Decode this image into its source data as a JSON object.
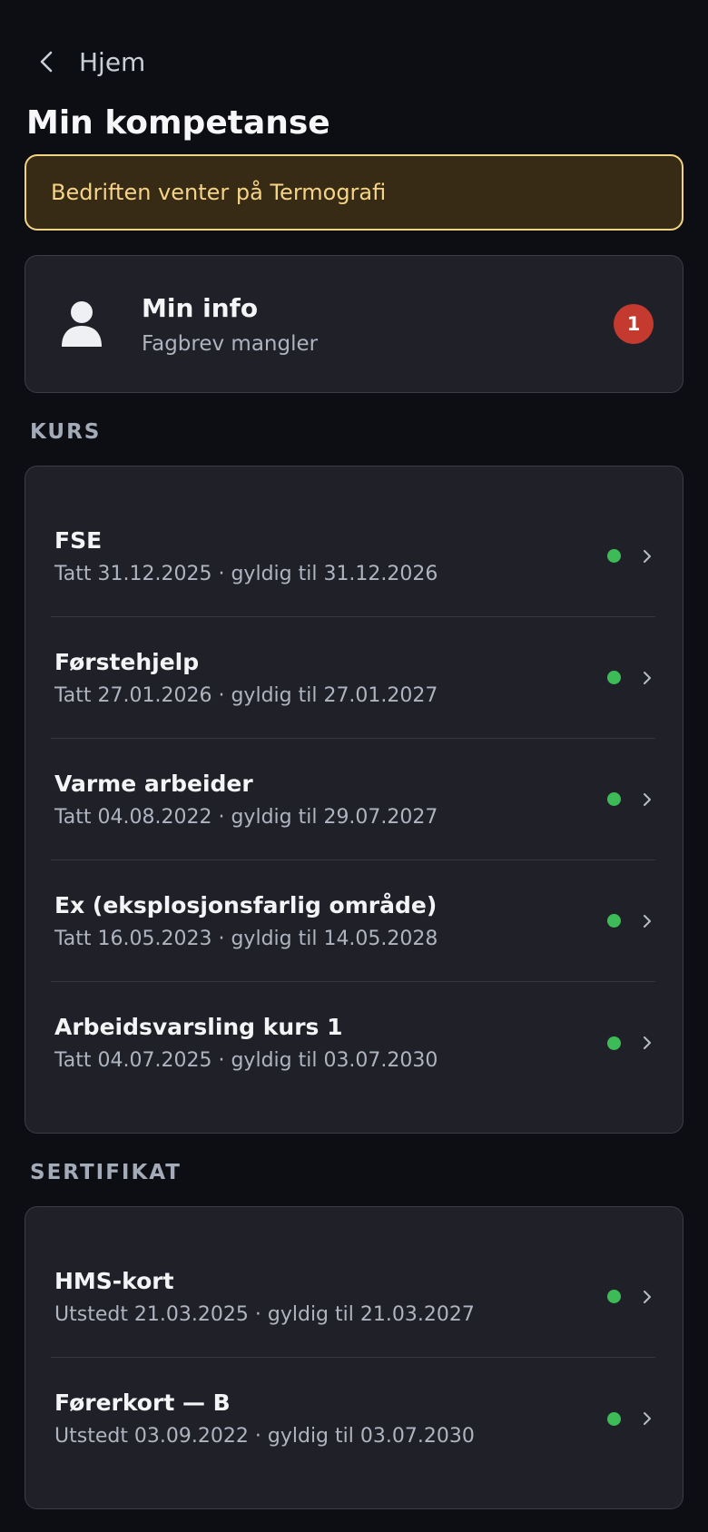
{
  "nav": {
    "back_label": "Hjem"
  },
  "page_title": "Min kompetanse",
  "notice": {
    "text": "Bedriften venter på Termografi"
  },
  "info_card": {
    "title": "Min info",
    "subtitle": "Fagbrev mangler",
    "badge_count": "1",
    "icon": "person-icon"
  },
  "sections": {
    "kurs": {
      "label": "KURS",
      "items": [
        {
          "title": "FSE",
          "subtitle": "Tatt 31.12.2025 · gyldig til 31.12.2026",
          "status": "valid"
        },
        {
          "title": "Førstehjelp",
          "subtitle": "Tatt 27.01.2026 · gyldig til 27.01.2027",
          "status": "valid"
        },
        {
          "title": "Varme arbeider",
          "subtitle": "Tatt 04.08.2022 · gyldig til 29.07.2027",
          "status": "valid"
        },
        {
          "title": "Ex (eksplosjonsfarlig område)",
          "subtitle": "Tatt 16.05.2023 · gyldig til 14.05.2028",
          "status": "valid"
        },
        {
          "title": "Arbeidsvarsling kurs 1",
          "subtitle": "Tatt 04.07.2025 · gyldig til 03.07.2030",
          "status": "valid"
        }
      ]
    },
    "sertifikat": {
      "label": "SERTIFIKAT",
      "items": [
        {
          "title": "HMS-kort",
          "subtitle": "Utstedt 21.03.2025 · gyldig til 21.03.2027",
          "status": "valid"
        },
        {
          "title": "Førerkort — B",
          "subtitle": "Utstedt 03.09.2022 · gyldig til 03.07.2030",
          "status": "valid"
        }
      ]
    }
  },
  "colors": {
    "background": "#0d0e13",
    "card": "#1f2028",
    "notice_bg": "#372b15",
    "notice_border": "#f1d483",
    "status_valid": "#3dbb57",
    "badge": "#c53a2e"
  }
}
